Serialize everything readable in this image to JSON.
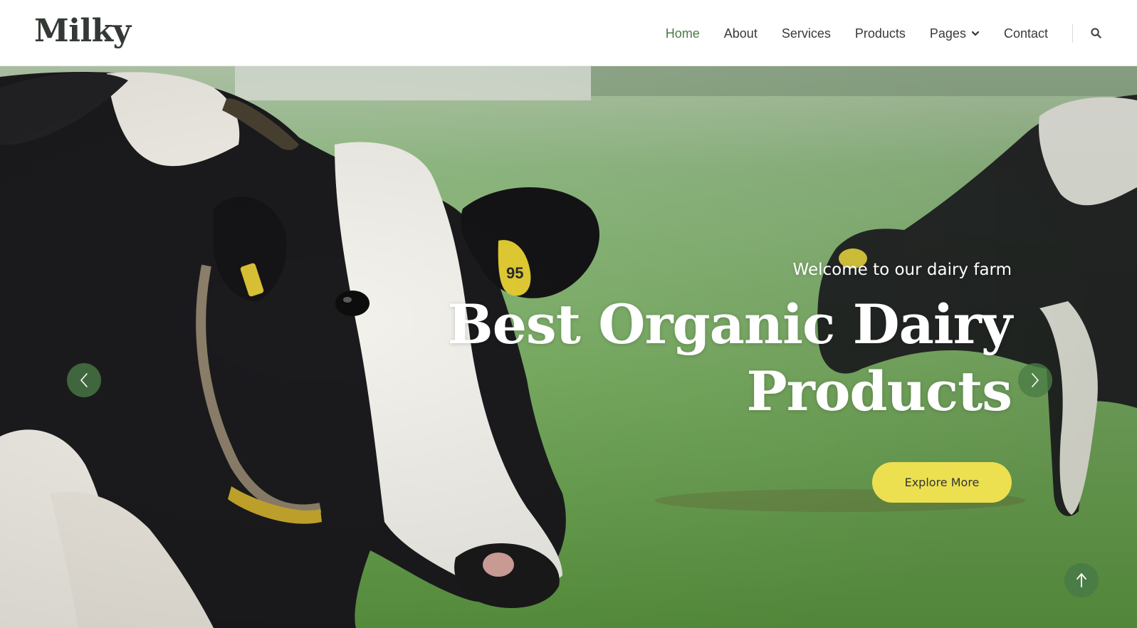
{
  "brand": {
    "name": "Milky"
  },
  "nav": {
    "items": [
      {
        "label": "Home",
        "active": true
      },
      {
        "label": "About"
      },
      {
        "label": "Services"
      },
      {
        "label": "Products"
      },
      {
        "label": "Pages",
        "dropdown": true
      },
      {
        "label": "Contact"
      }
    ],
    "search_icon": "search-icon"
  },
  "hero": {
    "subtitle": "Welcome to our dairy farm",
    "title_line1": "Best Organic Dairy",
    "title_line2": "Products",
    "cta_label": "Explore More",
    "ear_tag_number": "95",
    "prev_icon": "chevron-left-icon",
    "next_icon": "chevron-right-icon"
  },
  "back_to_top_icon": "arrow-up-icon",
  "colors": {
    "accent_green": "#4a7c45",
    "cta_yellow": "#ece050",
    "text_dark": "#3a3a3a"
  }
}
